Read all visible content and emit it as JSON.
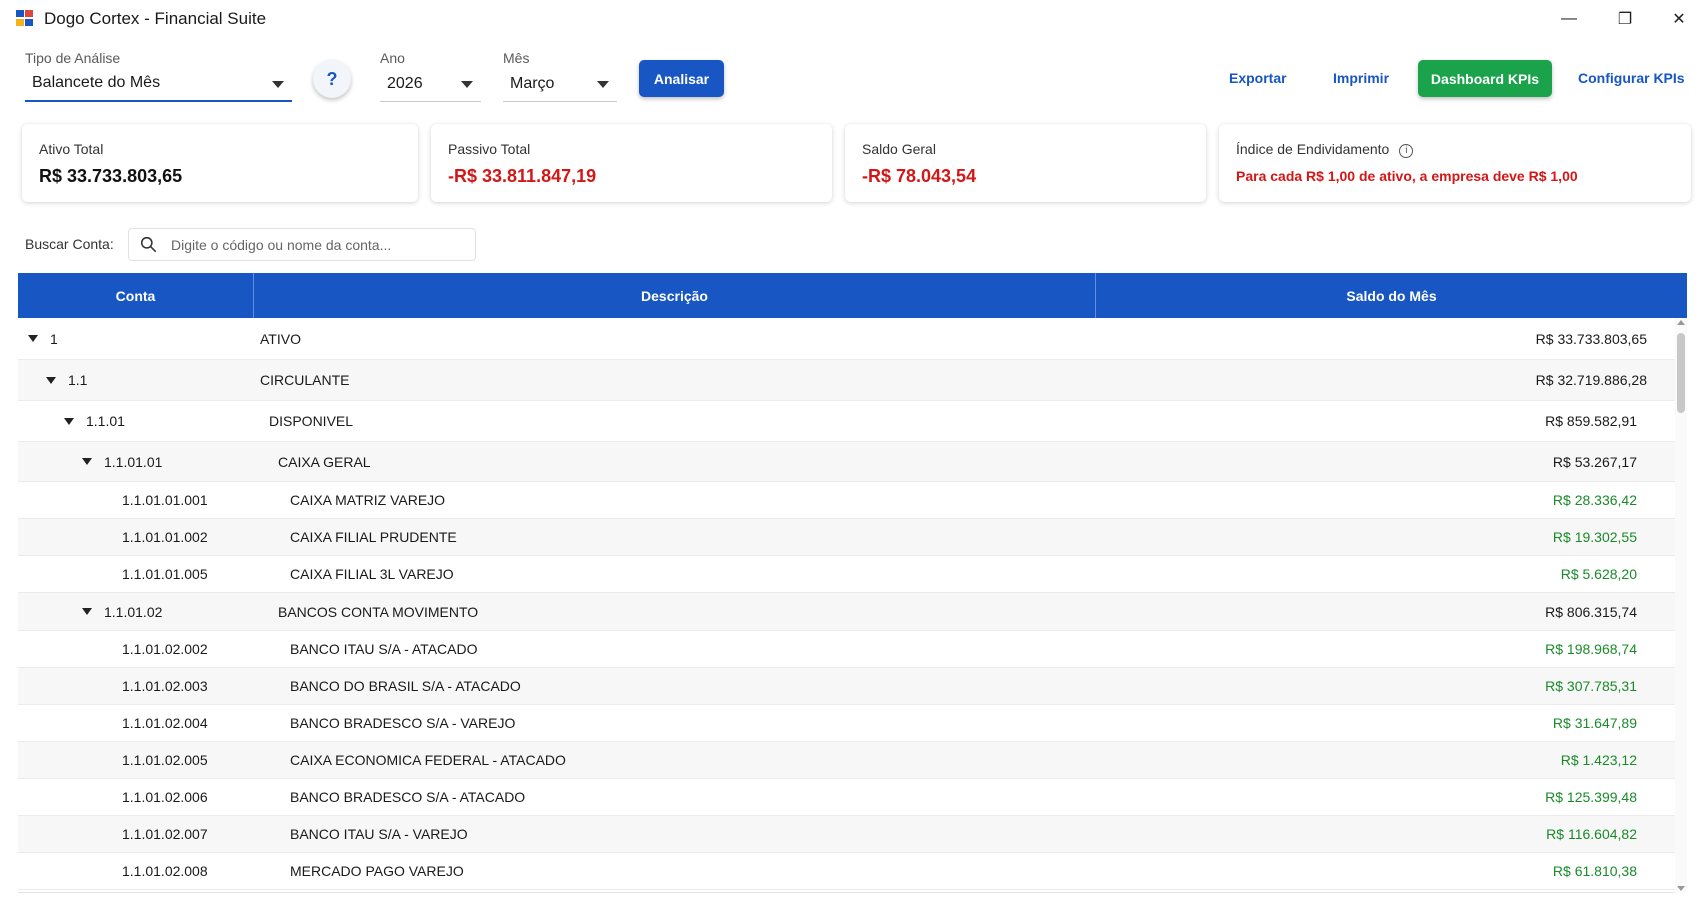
{
  "window": {
    "title": "Dogo Cortex - Financial Suite",
    "minimize_glyph": "—",
    "restore_glyph": "❐",
    "close_glyph": "✕"
  },
  "toolbar": {
    "analysis_type_label": "Tipo de Análise",
    "analysis_type_value": "Balancete do Mês",
    "help_label": "?",
    "year_label": "Ano",
    "year_value": "2026",
    "month_label": "Mês",
    "month_value": "Março",
    "analyze_label": "Analisar",
    "export_label": "Exportar",
    "print_label": "Imprimir",
    "dashboard_label": "Dashboard KPIs",
    "configure_label": "Configurar KPIs"
  },
  "cards": {
    "total_assets": {
      "label": "Ativo Total",
      "value": "R$ 33.733.803,65"
    },
    "total_liabilities": {
      "label": "Passivo Total",
      "value": "-R$ 33.811.847,19"
    },
    "general_balance": {
      "label": "Saldo Geral",
      "value": "-R$ 78.043,54"
    },
    "debt_index": {
      "label": "Índice de Endividamento",
      "info_glyph": "i",
      "message": "Para cada R$ 1,00 de ativo, a empresa deve R$ 1,00"
    }
  },
  "search": {
    "label": "Buscar Conta:",
    "placeholder": "Digite o código ou nome da conta..."
  },
  "table": {
    "columns": [
      "Conta",
      "Descrição",
      "Saldo do Mês"
    ],
    "rows": [
      {
        "code": "1",
        "description": "ATIVO",
        "value": "R$ 33.733.803,65",
        "level": 0,
        "expandable": true,
        "positive": false
      },
      {
        "code": "1.1",
        "description": "CIRCULANTE",
        "value": "R$ 32.719.886,28",
        "level": 1,
        "expandable": true,
        "positive": false
      },
      {
        "code": "1.1.01",
        "description": "DISPONIVEL",
        "value": "R$ 859.582,91",
        "level": 2,
        "expandable": true,
        "positive": false
      },
      {
        "code": "1.1.01.01",
        "description": "CAIXA GERAL",
        "value": "R$ 53.267,17",
        "level": 3,
        "expandable": true,
        "positive": false
      },
      {
        "code": "1.1.01.01.001",
        "description": "CAIXA MATRIZ VAREJO",
        "value": "R$ 28.336,42",
        "level": 4,
        "expandable": false,
        "positive": true
      },
      {
        "code": "1.1.01.01.002",
        "description": "CAIXA FILIAL PRUDENTE",
        "value": "R$ 19.302,55",
        "level": 4,
        "expandable": false,
        "positive": true
      },
      {
        "code": "1.1.01.01.005",
        "description": "CAIXA FILIAL 3L VAREJO",
        "value": "R$ 5.628,20",
        "level": 4,
        "expandable": false,
        "positive": true
      },
      {
        "code": "1.1.01.02",
        "description": "BANCOS CONTA MOVIMENTO",
        "value": "R$ 806.315,74",
        "level": 3,
        "expandable": true,
        "positive": false
      },
      {
        "code": "1.1.01.02.002",
        "description": "BANCO ITAU S/A - ATACADO",
        "value": "R$ 198.968,74",
        "level": 4,
        "expandable": false,
        "positive": true
      },
      {
        "code": "1.1.01.02.003",
        "description": "BANCO DO BRASIL S/A - ATACADO",
        "value": "R$ 307.785,31",
        "level": 4,
        "expandable": false,
        "positive": true
      },
      {
        "code": "1.1.01.02.004",
        "description": "BANCO BRADESCO S/A - VAREJO",
        "value": "R$ 31.647,89",
        "level": 4,
        "expandable": false,
        "positive": true
      },
      {
        "code": "1.1.01.02.005",
        "description": "CAIXA ECONOMICA FEDERAL - ATACADO",
        "value": "R$ 1.423,12",
        "level": 4,
        "expandable": false,
        "positive": true
      },
      {
        "code": "1.1.01.02.006",
        "description": "BANCO BRADESCO S/A - ATACADO",
        "value": "R$ 125.399,48",
        "level": 4,
        "expandable": false,
        "positive": true
      },
      {
        "code": "1.1.01.02.007",
        "description": "BANCO ITAU S/A - VAREJO",
        "value": "R$ 116.604,82",
        "level": 4,
        "expandable": false,
        "positive": true
      },
      {
        "code": "1.1.01.02.008",
        "description": "MERCADO PAGO VAREJO",
        "value": "R$ 61.810,38",
        "level": 4,
        "expandable": false,
        "positive": true
      }
    ]
  },
  "colors": {
    "primary": "#1756c3",
    "success": "#1aa34a",
    "negative": "#d31717",
    "positive_value": "#1a8a2a"
  }
}
